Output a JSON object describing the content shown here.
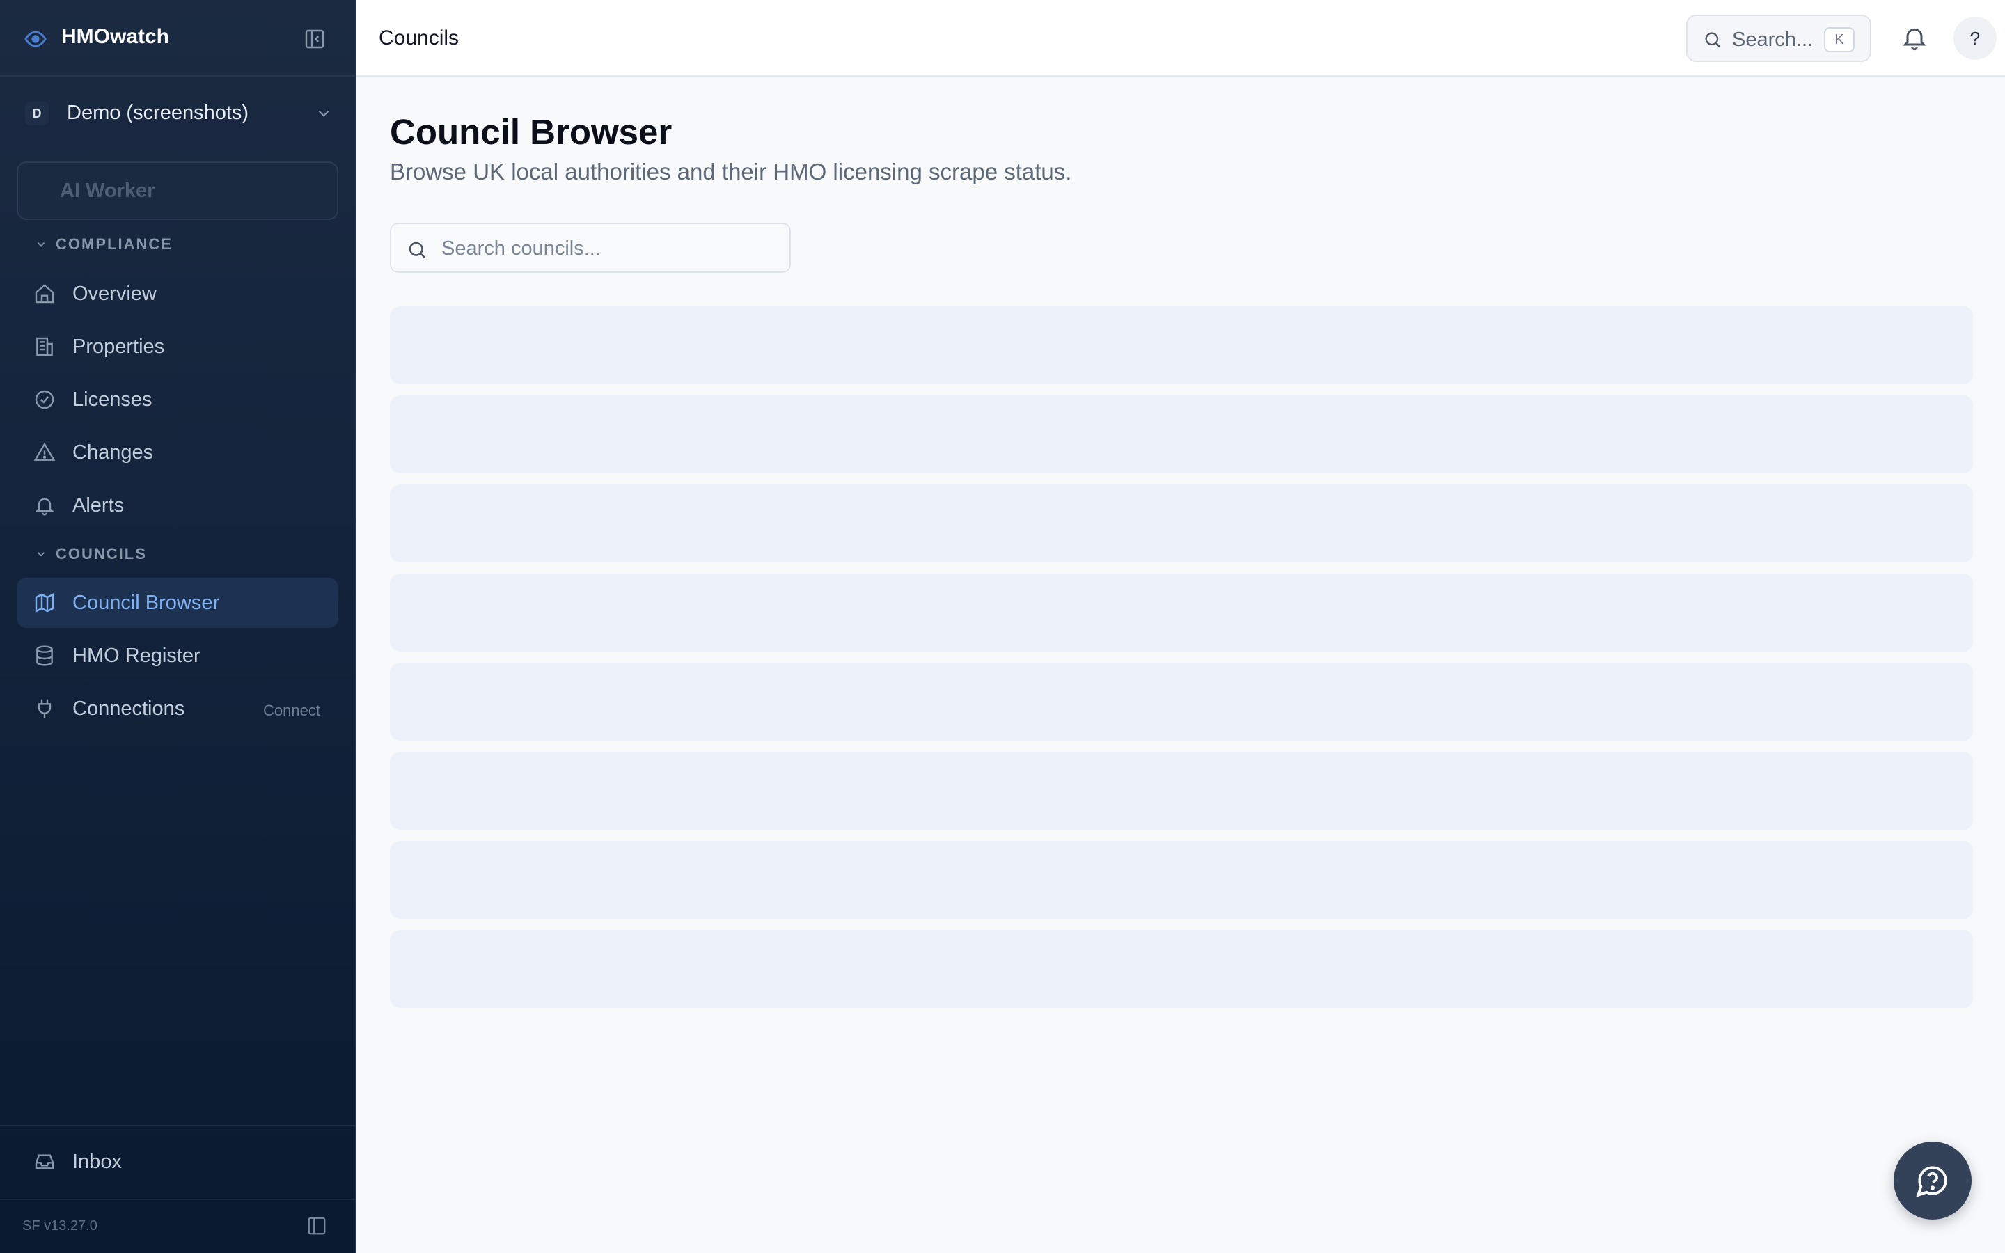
{
  "brand": {
    "name": "HMOwatch"
  },
  "workspace": {
    "initial": "D",
    "name": "Demo (screenshots)"
  },
  "ai_worker": {
    "label": "AI Worker"
  },
  "sections": {
    "compliance": "COMPLIANCE",
    "councils": "COUNCILS"
  },
  "nav": {
    "overview": "Overview",
    "properties": "Properties",
    "licenses": "Licenses",
    "changes": "Changes",
    "alerts": "Alerts",
    "council_browser": "Council Browser",
    "hmo_register": "HMO Register",
    "connections": "Connections",
    "connections_tag": "Connect",
    "inbox": "Inbox"
  },
  "version": "SF v13.27.0",
  "topbar": {
    "breadcrumb": "Councils",
    "search_label": "Search...",
    "shortcut_key": "K",
    "help_label": "?"
  },
  "main": {
    "title": "Council Browser",
    "subtitle": "Browse UK local authorities and their HMO licensing scrape status.",
    "search_placeholder": "Search councils..."
  },
  "loading_rows": 8,
  "colors": {
    "sidebar_bg": "#12233b",
    "active_item_bg": "#1d3150",
    "active_item_text": "#7fb0f4",
    "skeleton": "#edf1fa",
    "fab": "#334258"
  }
}
